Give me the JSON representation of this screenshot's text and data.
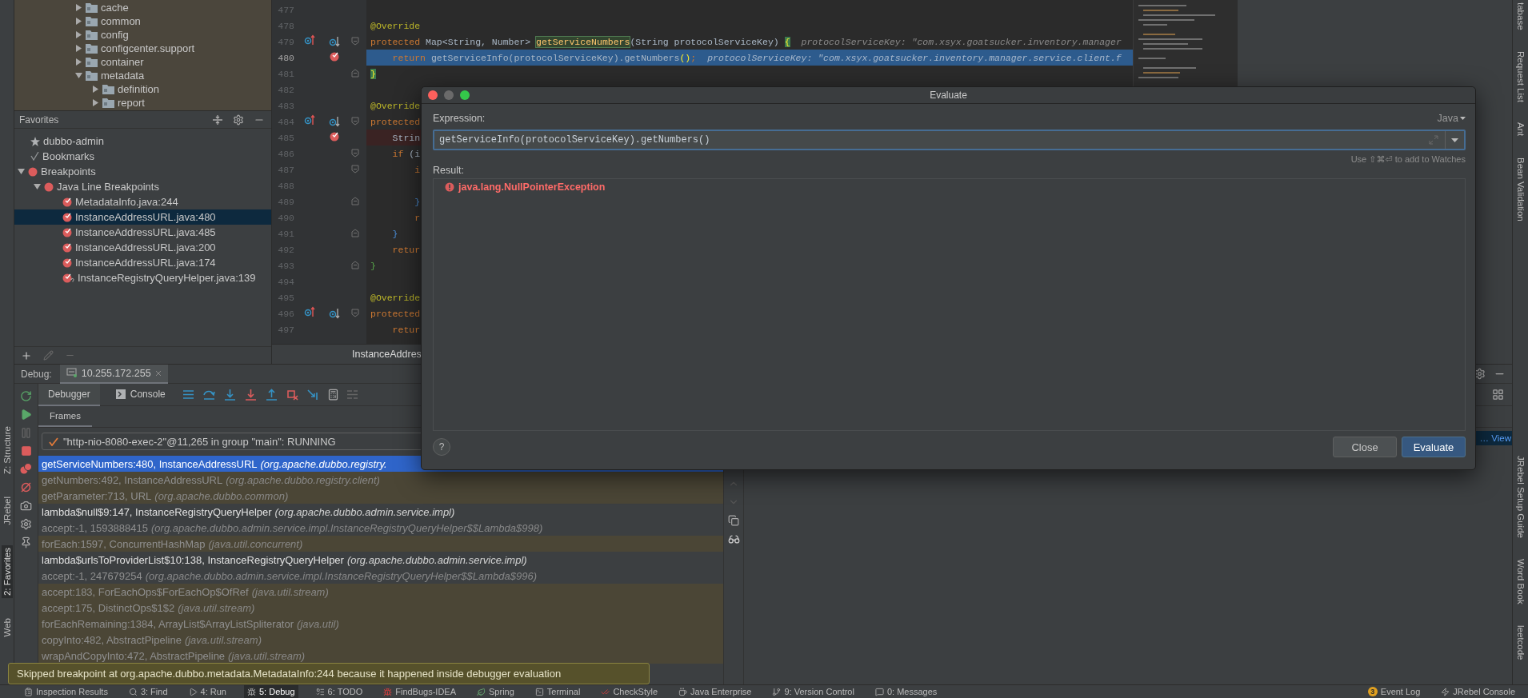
{
  "left_strip": [
    {
      "label": "Z: Structure",
      "selected": false
    },
    {
      "label": "JRebel",
      "selected": false
    },
    {
      "label": "2: Favorites",
      "selected": true
    },
    {
      "label": "Web",
      "selected": false
    }
  ],
  "right_strip": [
    {
      "label": "tabase"
    },
    {
      "label": "Request List"
    },
    {
      "label": "Ant"
    },
    {
      "label": "Bean Validation"
    },
    {
      "label": "JRebel Setup Guide"
    },
    {
      "label": "Word Book"
    },
    {
      "label": "leetcode"
    }
  ],
  "project_tree": [
    {
      "label": "cache",
      "expanded": false
    },
    {
      "label": "common",
      "expanded": false
    },
    {
      "label": "config",
      "expanded": false
    },
    {
      "label": "configcenter.support",
      "expanded": false
    },
    {
      "label": "container",
      "expanded": false
    },
    {
      "label": "metadata",
      "expanded": true,
      "children": [
        {
          "label": "definition",
          "expanded": false
        },
        {
          "label": "report",
          "expanded": false
        }
      ]
    }
  ],
  "favorites": {
    "title": "Favorites",
    "items": [
      {
        "label": "dubbo-admin",
        "kind": "project",
        "selected": false
      },
      {
        "label": "Bookmarks",
        "kind": "bookmarks",
        "selected": false
      },
      {
        "label": "Breakpoints",
        "kind": "group",
        "selected": false,
        "expanded": true,
        "children": [
          {
            "label": "Java Line Breakpoints",
            "kind": "group",
            "selected": false,
            "expanded": true,
            "children": [
              {
                "label": "MetadataInfo.java:244",
                "kind": "breakpoint",
                "selected": false
              },
              {
                "label": "InstanceAddressURL.java:480",
                "kind": "breakpoint",
                "selected": true
              },
              {
                "label": "InstanceAddressURL.java:485",
                "kind": "breakpoint",
                "selected": false
              },
              {
                "label": "InstanceAddressURL.java:200",
                "kind": "breakpoint",
                "selected": false
              },
              {
                "label": "InstanceAddressURL.java:174",
                "kind": "breakpoint",
                "selected": false
              },
              {
                "label": "InstanceRegistryQueryHelper.java:139",
                "kind": "breakpoint-conditional",
                "selected": false
              }
            ]
          }
        ]
      }
    ]
  },
  "editor": {
    "tab": "InstanceAddres",
    "lines": [
      {
        "number": "477"
      },
      {
        "number": "478",
        "tokens": [
          {
            "text": "@Override",
            "kind": "annotation"
          }
        ]
      },
      {
        "number": "479",
        "override_marks": true,
        "fold_start": true,
        "tokens": [
          {
            "text": "protected",
            "kind": "keyword"
          },
          {
            "text": " Map<String, Number> ",
            "kind": "plain"
          },
          {
            "text": "getServiceNumbers",
            "kind": "declaration"
          },
          {
            "text": "(String protocolServiceKey) ",
            "kind": "plain"
          },
          {
            "text": "{",
            "kind": "brace-match"
          }
        ],
        "hint": "protocolServiceKey: \"com.xsyx.goatsucker.inventory.manager"
      },
      {
        "number": "480",
        "breakpoint": true,
        "current": true,
        "tokens": [
          {
            "text": "    return",
            "kind": "keyword"
          },
          {
            "text": " getServiceInfo(protocolServiceKey).getNumbers",
            "kind": "plain"
          },
          {
            "text": "()",
            "kind": "paren-match"
          },
          {
            "text": ";",
            "kind": "keyword"
          }
        ],
        "hint": "protocolServiceKey: \"com.xsyx.goatsucker.inventory.manager.service.client.f"
      },
      {
        "number": "481",
        "fold_end": true,
        "tokens": [
          {
            "text": "}",
            "kind": "brace-match"
          }
        ]
      },
      {
        "number": "482"
      },
      {
        "number": "483",
        "tokens": [
          {
            "text": "@Override",
            "kind": "annotation"
          }
        ]
      },
      {
        "number": "484",
        "override_marks": true,
        "fold_start": true,
        "tokens": [
          {
            "text": "protected",
            "kind": "keyword"
          }
        ]
      },
      {
        "number": "485",
        "breakpoint": true,
        "current": false,
        "tokens": [
          {
            "text": "    Strin",
            "kind": "plain"
          }
        ]
      },
      {
        "number": "486",
        "fold_start": true,
        "tokens": [
          {
            "text": "    if",
            "kind": "keyword"
          },
          {
            "text": " (i",
            "kind": "plain"
          }
        ]
      },
      {
        "number": "487",
        "fold_start": true,
        "tokens": [
          {
            "text": "        i",
            "kind": "keyword"
          }
        ]
      },
      {
        "number": "488"
      },
      {
        "number": "489",
        "fold_end": true,
        "tokens": [
          {
            "text": "        }",
            "kind": "bracket-blue"
          }
        ]
      },
      {
        "number": "490",
        "tokens": [
          {
            "text": "        r",
            "kind": "keyword"
          }
        ]
      },
      {
        "number": "491",
        "fold_end": true,
        "tokens": [
          {
            "text": "    }",
            "kind": "bracket-blue"
          }
        ]
      },
      {
        "number": "492",
        "tokens": [
          {
            "text": "    retur",
            "kind": "keyword"
          }
        ]
      },
      {
        "number": "493",
        "fold_end": true,
        "tokens": [
          {
            "text": "}",
            "kind": "bracket-green"
          }
        ]
      },
      {
        "number": "494"
      },
      {
        "number": "495",
        "tokens": [
          {
            "text": "@Override",
            "kind": "annotation"
          }
        ]
      },
      {
        "number": "496",
        "override_marks": true,
        "fold_start": true,
        "tokens": [
          {
            "text": "protected",
            "kind": "keyword"
          }
        ]
      },
      {
        "number": "497",
        "tokens": [
          {
            "text": "    retur",
            "kind": "keyword"
          }
        ]
      }
    ]
  },
  "debug": {
    "title": "Debug:",
    "session": "10.255.172.255",
    "tabs": [
      {
        "label": "Debugger",
        "selected": true
      },
      {
        "label": "Console",
        "selected": false
      }
    ],
    "frames_tab": "Frames",
    "thread": "\"http-nio-8080-exec-2\"@11,265 in group \"main\": RUNNING",
    "variables_link": "… View",
    "frames": [
      {
        "method": "getServiceNumbers:480, InstanceAddressURL",
        "package": "(org.apache.dubbo.registry.",
        "kind": "user",
        "selected": true
      },
      {
        "method": "getNumbers:492, InstanceAddressURL",
        "package": "(org.apache.dubbo.registry.client)",
        "kind": "library",
        "selected": false
      },
      {
        "method": "getParameter:713, URL",
        "package": "(org.apache.dubbo.common)",
        "kind": "library",
        "selected": false
      },
      {
        "method": "lambda$null$9:147, InstanceRegistryQueryHelper",
        "package": "(org.apache.dubbo.admin.service.impl)",
        "kind": "user",
        "selected": false
      },
      {
        "method": "accept:-1, 1593888415",
        "package": "(org.apache.dubbo.admin.service.impl.InstanceRegistryQueryHelper$$Lambda$998)",
        "kind": "synthetic",
        "selected": false
      },
      {
        "method": "forEach:1597, ConcurrentHashMap",
        "package": "(java.util.concurrent)",
        "kind": "library",
        "selected": false
      },
      {
        "method": "lambda$urlsToProviderList$10:138, InstanceRegistryQueryHelper",
        "package": "(org.apache.dubbo.admin.service.impl)",
        "kind": "user",
        "selected": false
      },
      {
        "method": "accept:-1, 247679254",
        "package": "(org.apache.dubbo.admin.service.impl.InstanceRegistryQueryHelper$$Lambda$996)",
        "kind": "synthetic",
        "selected": false
      },
      {
        "method": "accept:183, ForEachOps$ForEachOp$OfRef",
        "package": "(java.util.stream)",
        "kind": "library",
        "selected": false
      },
      {
        "method": "accept:175, DistinctOps$1$2",
        "package": "(java.util.stream)",
        "kind": "library",
        "selected": false
      },
      {
        "method": "forEachRemaining:1384, ArrayList$ArrayListSpliterator",
        "package": "(java.util)",
        "kind": "library",
        "selected": false
      },
      {
        "method": "copyInto:482, AbstractPipeline",
        "package": "(java.util.stream)",
        "kind": "library",
        "selected": false
      },
      {
        "method": "wrapAndCopyInto:472, AbstractPipeline",
        "package": "(java.util.stream)",
        "kind": "library",
        "selected": false
      }
    ]
  },
  "dialog": {
    "title": "Evaluate",
    "expression_label": "Expression:",
    "language": "Java",
    "expression": "getServiceInfo(protocolServiceKey).getNumbers()",
    "watch_hint": "Use ⇧⌘⏎ to add to Watches",
    "result_label": "Result:",
    "result": "java.lang.NullPointerException",
    "help": "?",
    "buttons": [
      {
        "label": "Close",
        "primary": false
      },
      {
        "label": "Evaluate",
        "primary": true
      }
    ]
  },
  "notification": "Skipped breakpoint at org.apache.dubbo.metadata.MetadataInfo:244 because it happened inside debugger evaluation",
  "status_bar": {
    "tools": [
      {
        "label": "Inspection Results",
        "selected": false
      },
      {
        "label": "3: Find",
        "selected": false
      },
      {
        "label": "4: Run",
        "selected": false
      },
      {
        "label": "5: Debug",
        "selected": true
      },
      {
        "label": "6: TODO",
        "selected": false
      },
      {
        "label": "FindBugs-IDEA",
        "selected": false
      },
      {
        "label": "Spring",
        "selected": false
      },
      {
        "label": "Terminal",
        "selected": false
      },
      {
        "label": "CheckStyle",
        "selected": false
      },
      {
        "label": "Java Enterprise",
        "selected": false
      },
      {
        "label": "9: Version Control",
        "selected": false
      },
      {
        "label": "0: Messages",
        "selected": false
      }
    ],
    "event_log": {
      "label": "Event Log",
      "count": "3"
    },
    "console": "JRebel Console"
  }
}
